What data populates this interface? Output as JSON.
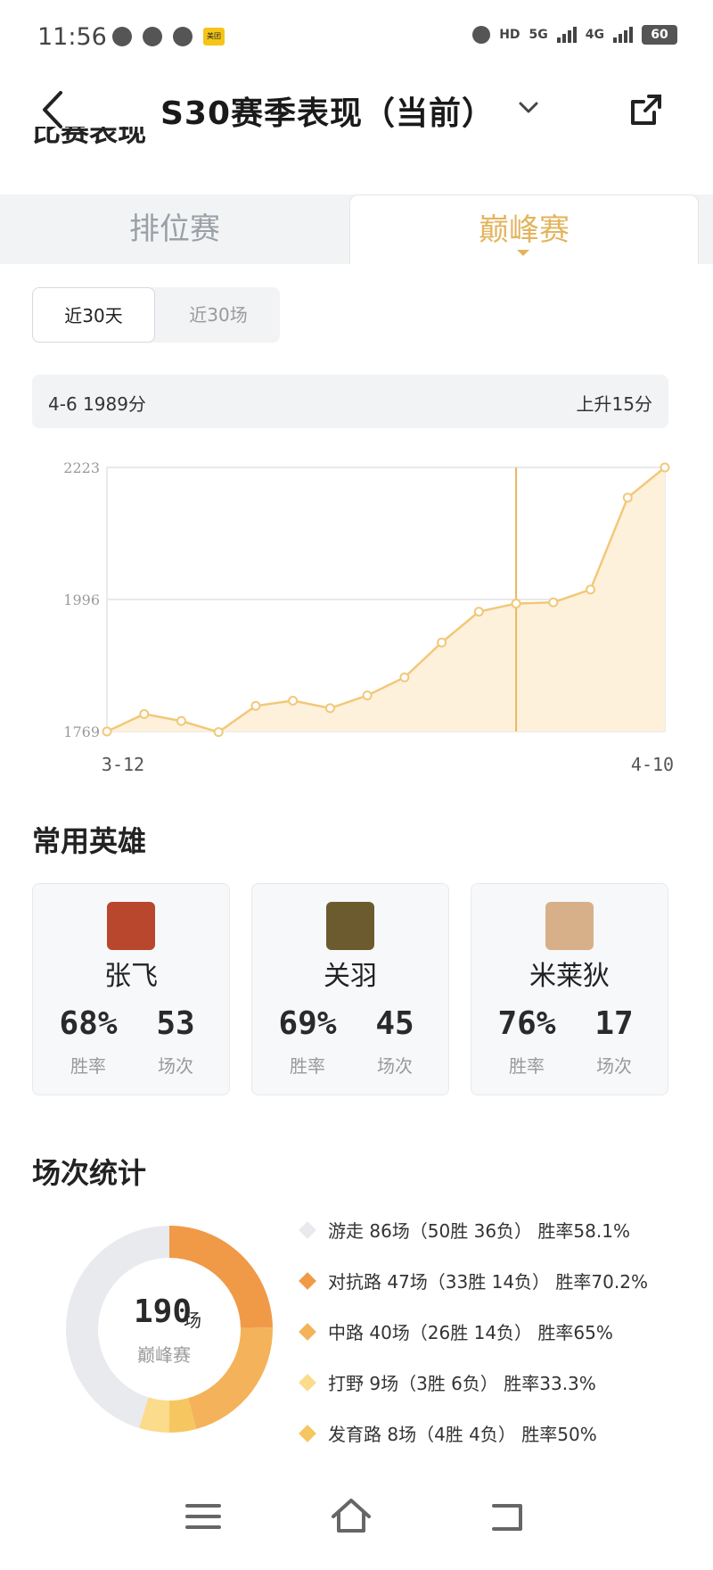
{
  "status_bar": {
    "time": "11:56",
    "app_badge": "美团",
    "network_hd": "HD",
    "network_5g": "5G",
    "network_4g": "4G",
    "battery": "60"
  },
  "header": {
    "title": "S30赛季表现（当前）",
    "scrolled_section_title": "比赛表现"
  },
  "tabs": [
    {
      "label": "排位赛",
      "active": false
    },
    {
      "label": "巅峰赛",
      "active": true
    }
  ],
  "range": [
    {
      "label": "近30天",
      "active": true
    },
    {
      "label": "近30场",
      "active": false
    }
  ],
  "summary": {
    "left": "4-6 1989分",
    "right": "上升15分"
  },
  "chart_data": {
    "type": "area",
    "yticks": [
      "2223",
      "1996",
      "1769"
    ],
    "ylim": [
      1769,
      2223
    ],
    "x_start_label": "3-12",
    "x_end_label": "4-10",
    "values": [
      1769,
      1799,
      1787,
      1768,
      1813,
      1822,
      1809,
      1831,
      1862,
      1922,
      1975,
      1989,
      1991,
      2013,
      2171,
      2223
    ],
    "highlight_index": 11,
    "grid": true,
    "colors": {
      "line": "#f2c879",
      "fill": "#fdf1dc",
      "point": "#f2c879",
      "crosshair": "#e8b860"
    }
  },
  "heroes_section": {
    "title": "常用英雄",
    "heroes": [
      {
        "name": "张飞",
        "win_rate": "68%",
        "win_label": "胜率",
        "matches": "53",
        "matches_label": "场次",
        "avatar_color": "#b9472e"
      },
      {
        "name": "关羽",
        "win_rate": "69%",
        "win_label": "胜率",
        "matches": "45",
        "matches_label": "场次",
        "avatar_color": "#6b5b2f"
      },
      {
        "name": "米莱狄",
        "win_rate": "76%",
        "win_label": "胜率",
        "matches": "17",
        "matches_label": "场次",
        "avatar_color": "#d7b08a"
      }
    ]
  },
  "stats_section": {
    "title": "场次统计",
    "total": "190",
    "total_unit": "场",
    "total_sub": "巅峰赛",
    "roles": [
      {
        "text": "游走 86场（50胜 36负） 胜率58.1%",
        "matches": 86,
        "color": "#e8eaed"
      },
      {
        "text": "对抗路 47场（33胜 14负） 胜率70.2%",
        "matches": 47,
        "color": "#f09a48"
      },
      {
        "text": "中路 40场（26胜 14负） 胜率65%",
        "matches": 40,
        "color": "#f4b35a"
      },
      {
        "text": "打野 9场（3胜 6负） 胜率33.3%",
        "matches": 9,
        "color": "#fbdb8c"
      },
      {
        "text": "发育路 8场（4胜 4负） 胜率50%",
        "matches": 8,
        "color": "#f6c661"
      }
    ]
  }
}
